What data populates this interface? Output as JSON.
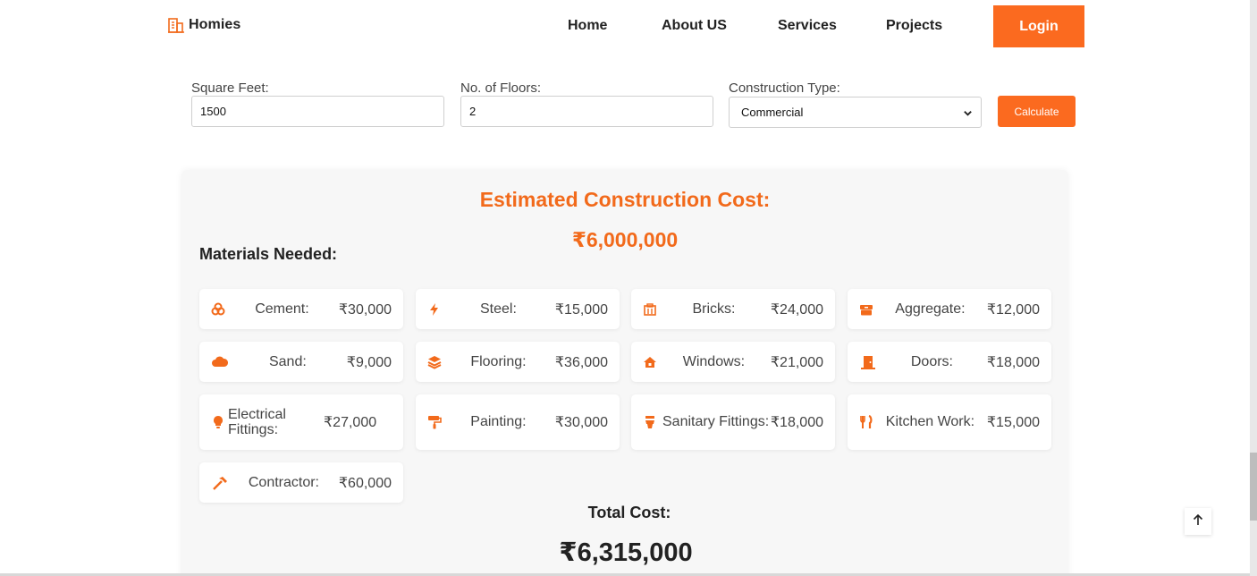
{
  "brand": {
    "name": "Homies",
    "icon": "building-icon"
  },
  "nav": {
    "items": [
      {
        "label": "Home"
      },
      {
        "label": "About US"
      },
      {
        "label": "Services"
      },
      {
        "label": "Projects"
      }
    ],
    "login_label": "Login"
  },
  "form": {
    "square_feet": {
      "label": "Square Feet:",
      "value": "1500"
    },
    "floors": {
      "label": "No. of Floors:",
      "value": "2"
    },
    "construction_type": {
      "label": "Construction Type:",
      "value": "Commercial"
    },
    "calculate_label": "Calculate"
  },
  "result": {
    "title": "Estimated Construction Cost:",
    "value": "₹6,000,000",
    "materials_title": "Materials Needed:",
    "materials": [
      {
        "label": "Cement:",
        "value": "₹30,000",
        "icon": "cubes-icon"
      },
      {
        "label": "Steel:",
        "value": "₹15,000",
        "icon": "bolt-icon"
      },
      {
        "label": "Bricks:",
        "value": "₹24,000",
        "icon": "building-icon"
      },
      {
        "label": "Aggregate:",
        "value": "₹12,000",
        "icon": "box-icon"
      },
      {
        "label": "Sand:",
        "value": "₹9,000",
        "icon": "cloud-icon"
      },
      {
        "label": "Flooring:",
        "value": "₹36,000",
        "icon": "layers-icon"
      },
      {
        "label": "Windows:",
        "value": "₹21,000",
        "icon": "house-icon"
      },
      {
        "label": "Doors:",
        "value": "₹18,000",
        "icon": "door-icon"
      },
      {
        "label": "Electrical Fittings:",
        "value": "₹27,000",
        "icon": "lightbulb-icon"
      },
      {
        "label": "Painting:",
        "value": "₹30,000",
        "icon": "paint-roller-icon"
      },
      {
        "label": "Sanitary Fittings:",
        "value": "₹18,000",
        "icon": "toilet-icon"
      },
      {
        "label": "Kitchen Work:",
        "value": "₹15,000",
        "icon": "utensils-icon"
      },
      {
        "label": "Contractor:",
        "value": "₹60,000",
        "icon": "hammer-icon"
      }
    ],
    "total_label": "Total Cost:",
    "total_value": "₹6,315,000"
  },
  "scroll_top_icon": "arrow-up-icon",
  "colors": {
    "accent": "#fb6a1f",
    "accent_text": "#f26a1b"
  }
}
